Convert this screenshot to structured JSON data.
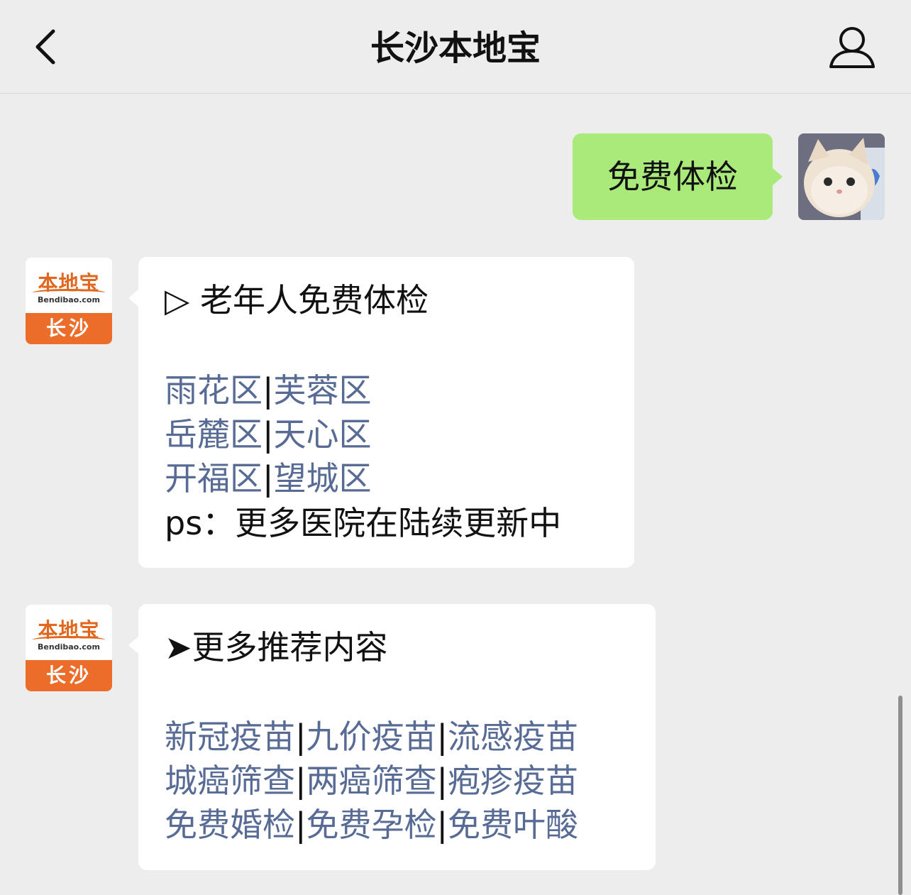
{
  "header": {
    "title": "长沙本地宝",
    "back_icon": "chevron-left-icon",
    "profile_icon": "person-icon"
  },
  "user_message": {
    "text": "免费体检"
  },
  "bot": {
    "logo_brand": "本地宝",
    "logo_domain": "Bendibao.com",
    "logo_city": "长沙"
  },
  "message1": {
    "heading": "▷ 老年人免费体检",
    "rows": [
      [
        "雨花区",
        "芙蓉区"
      ],
      [
        "岳麓区",
        "天心区"
      ],
      [
        "开福区",
        "望城区"
      ]
    ],
    "separator": "|",
    "note": "ps：更多医院在陆续更新中"
  },
  "message2": {
    "heading": "➤更多推荐内容",
    "rows": [
      [
        "新冠疫苗",
        "九价疫苗",
        "流感疫苗"
      ],
      [
        "城癌筛查",
        "两癌筛查",
        "疱疹疫苗"
      ],
      [
        "免费婚检",
        "免费孕检",
        "免费叶酸"
      ]
    ],
    "separator": "|"
  },
  "colors": {
    "background": "#ededed",
    "user_bubble": "#a9ea7a",
    "link": "#576b95",
    "brand_orange": "#ec6c2a"
  }
}
